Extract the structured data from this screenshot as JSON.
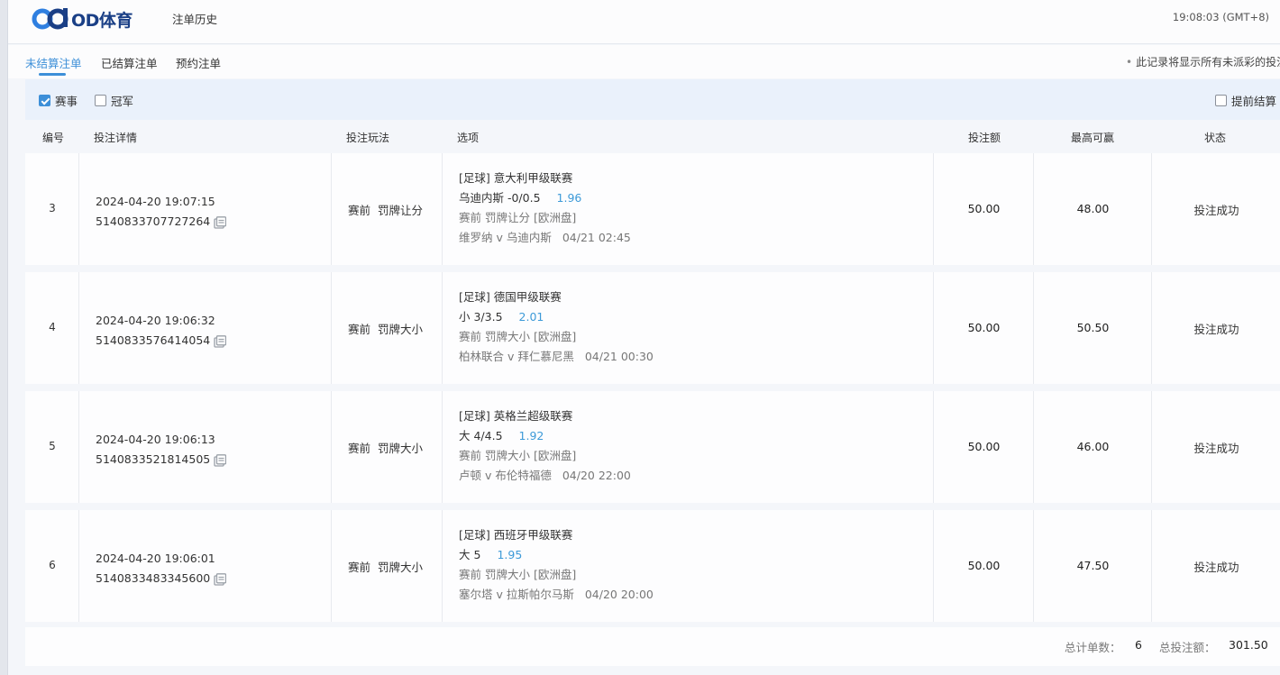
{
  "header": {
    "logo_text": "OD体育",
    "page_title": "注单历史",
    "clock": "19:08:03 (GMT+8)"
  },
  "tabs": [
    {
      "label": "未结算注单",
      "active": true
    },
    {
      "label": "已结算注单",
      "active": false
    },
    {
      "label": "预约注单",
      "active": false
    }
  ],
  "notice": "此记录将显示所有未派彩的投注",
  "filters": {
    "event": {
      "label": "赛事",
      "checked": true
    },
    "champion": {
      "label": "冠军",
      "checked": false
    },
    "early_settle": {
      "label": "提前结算",
      "checked": false
    }
  },
  "columns": {
    "no": "编号",
    "detail": "投注详情",
    "play": "投注玩法",
    "option": "选项",
    "amount": "投注额",
    "max_win": "最高可赢",
    "status": "状态"
  },
  "rows": [
    {
      "no": "3",
      "datetime": "2024-04-20 19:07:15",
      "bet_id": "5140833707727264",
      "play": "赛前  罚牌让分",
      "league": "[足球] 意大利甲级联赛",
      "selection": "乌迪内斯 -0/0.5",
      "odds": "1.96",
      "sub": "赛前 罚牌让分 [欧洲盘]",
      "match": "维罗纳 v 乌迪内斯",
      "match_time": "04/21 02:45",
      "amount": "50.00",
      "max_win": "48.00",
      "status": "投注成功"
    },
    {
      "no": "4",
      "datetime": "2024-04-20 19:06:32",
      "bet_id": "5140833576414054",
      "play": "赛前  罚牌大小",
      "league": "[足球] 德国甲级联赛",
      "selection": "小 3/3.5",
      "odds": "2.01",
      "sub": "赛前 罚牌大小 [欧洲盘]",
      "match": "柏林联合 v 拜仁慕尼黑",
      "match_time": "04/21 00:30",
      "amount": "50.00",
      "max_win": "50.50",
      "status": "投注成功"
    },
    {
      "no": "5",
      "datetime": "2024-04-20 19:06:13",
      "bet_id": "5140833521814505",
      "play": "赛前  罚牌大小",
      "league": "[足球] 英格兰超级联赛",
      "selection": "大 4/4.5",
      "odds": "1.92",
      "sub": "赛前 罚牌大小 [欧洲盘]",
      "match": "卢顿 v 布伦特福德",
      "match_time": "04/20 22:00",
      "amount": "50.00",
      "max_win": "46.00",
      "status": "投注成功"
    },
    {
      "no": "6",
      "datetime": "2024-04-20 19:06:01",
      "bet_id": "5140833483345600",
      "play": "赛前  罚牌大小",
      "league": "[足球] 西班牙甲级联赛",
      "selection": "大 5",
      "odds": "1.95",
      "sub": "赛前 罚牌大小 [欧洲盘]",
      "match": "塞尔塔 v 拉斯帕尔马斯",
      "match_time": "04/20 20:00",
      "amount": "50.00",
      "max_win": "47.50",
      "status": "投注成功"
    }
  ],
  "footer": {
    "count_label": "总计单数：",
    "count": "6",
    "total_label": "总投注额：",
    "total": "301.50"
  },
  "colors": {
    "accent": "#3d8fd8",
    "odds": "#3d9ad8",
    "logo": "#1a3f86"
  },
  "icons": {
    "copy": "copy-icon",
    "logo": "od-logo-icon"
  }
}
